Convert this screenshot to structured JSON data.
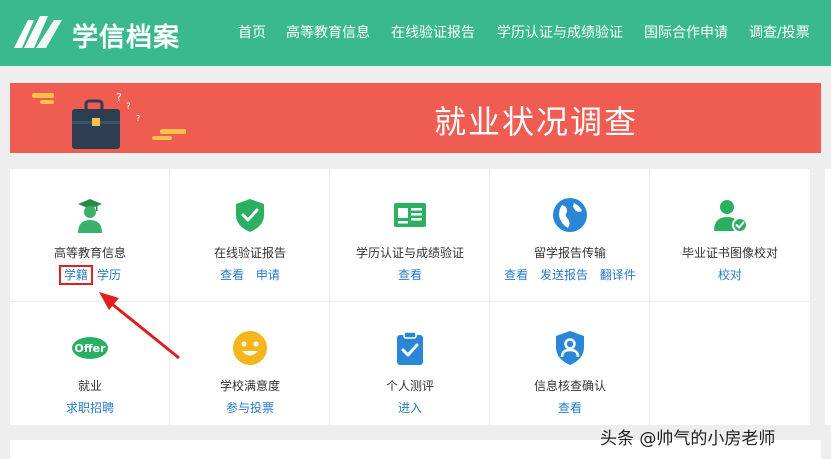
{
  "header": {
    "brand": "学信档案",
    "nav": [
      {
        "label": "首页"
      },
      {
        "label": "高等教育信息"
      },
      {
        "label": "在线验证报告"
      },
      {
        "label": "学历认证与成绩验证"
      },
      {
        "label": "国际合作申请"
      },
      {
        "label": "调查/投票"
      }
    ]
  },
  "banner": {
    "title": "就业状况调查"
  },
  "services": [
    {
      "title": "高等教育信息",
      "icon": "graduate-icon",
      "links": [
        "学籍",
        "学历"
      ]
    },
    {
      "title": "在线验证报告",
      "icon": "shield-check-icon",
      "links": [
        "查看",
        "申请"
      ]
    },
    {
      "title": "学历认证与成绩验证",
      "icon": "id-card-icon",
      "links": [
        "查看"
      ]
    },
    {
      "title": "留学报告传输",
      "icon": "globe-icon",
      "links": [
        "查看",
        "发送报告",
        "翻译件"
      ]
    },
    {
      "title": "毕业证书图像校对",
      "icon": "user-check-icon",
      "links": [
        "校对"
      ]
    },
    {
      "title": "就业",
      "icon": "offer-icon",
      "links": [
        "求职招聘"
      ],
      "badge": "Offer"
    },
    {
      "title": "学校满意度",
      "icon": "smiley-icon",
      "links": [
        "参与投票"
      ]
    },
    {
      "title": "个人测评",
      "icon": "clipboard-check-icon",
      "links": [
        "进入"
      ]
    },
    {
      "title": "信息核查确认",
      "icon": "user-shield-icon",
      "links": [
        "查看"
      ]
    }
  ],
  "colors": {
    "header_bg": "#3ab98e",
    "banner_bg": "#ef5d52",
    "link": "#2a7bc8",
    "highlight": "#e02020"
  },
  "watermark": "头条 @帅气的小房老师"
}
